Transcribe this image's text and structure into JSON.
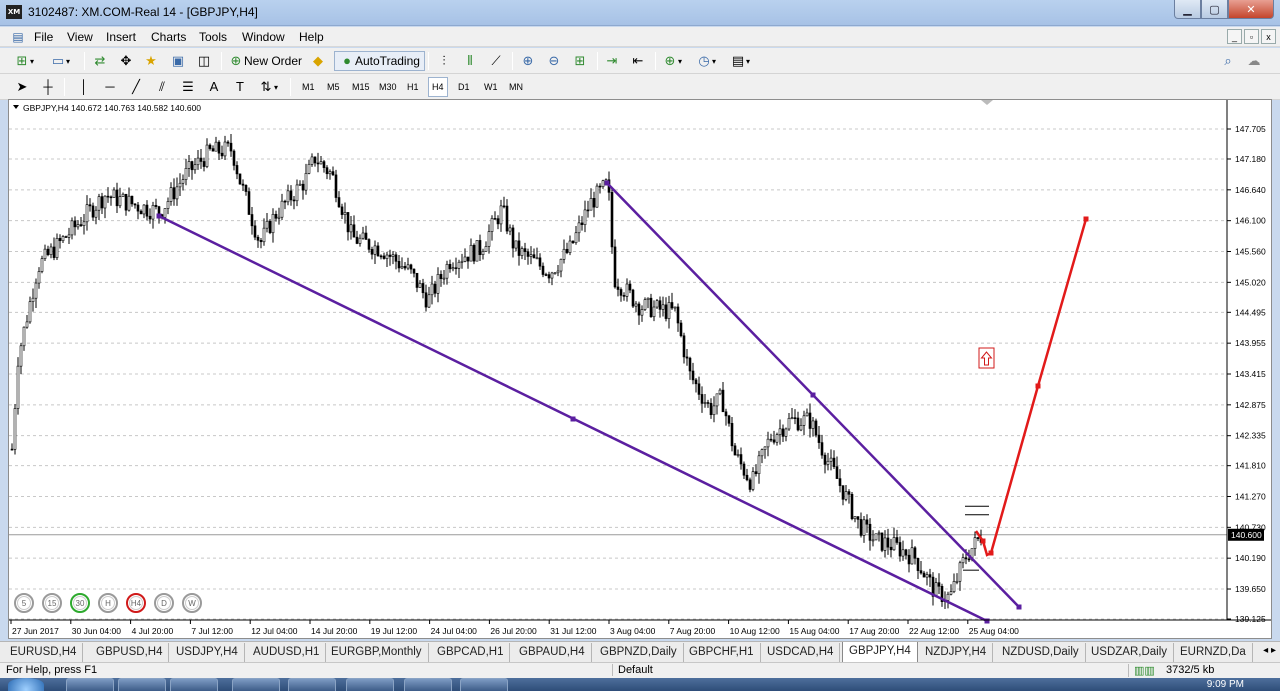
{
  "window": {
    "title": "3102487: XM.COM-Real 14 - [GBPJPY,H4]",
    "app_icon": "XM",
    "buttons": {
      "minimize": "▁",
      "maximize": "▢",
      "close": "✕"
    }
  },
  "menu": {
    "items": [
      "File",
      "View",
      "Insert",
      "Charts",
      "Tools",
      "Window",
      "Help"
    ],
    "mdi": [
      "_",
      "▫",
      "x"
    ]
  },
  "toolbar": {
    "new_order": "New Order",
    "autotrading": "AutoTrading",
    "timeframes": [
      "M1",
      "M5",
      "M15",
      "M30",
      "H1",
      "H4",
      "D1",
      "W1",
      "MN"
    ],
    "active_timeframe": "H4",
    "tools_text": "A"
  },
  "chart": {
    "header": "GBPJPY,H4  140.672 140.763 140.582 140.600",
    "current_price": "140.600",
    "price_labels": [
      "147.705",
      "147.180",
      "146.640",
      "146.100",
      "145.560",
      "145.020",
      "144.495",
      "143.955",
      "143.415",
      "142.875",
      "142.335",
      "141.810",
      "141.270",
      "140.730",
      "140.190",
      "139.650",
      "139.125"
    ],
    "time_labels": [
      "27 Jun 2017",
      "30 Jun 04:00",
      "4 Jul 20:00",
      "7 Jul 12:00",
      "12 Jul 04:00",
      "14 Jul 20:00",
      "19 Jul 12:00",
      "24 Jul 04:00",
      "26 Jul 20:00",
      "31 Jul 12:00",
      "3 Aug 04:00",
      "7 Aug 20:00",
      "10 Aug 12:00",
      "15 Aug 04:00",
      "17 Aug 20:00",
      "22 Aug 12:00",
      "25 Aug 04:00"
    ],
    "timeframe_circles": [
      {
        "label": "5",
        "color": "#9a9a9a"
      },
      {
        "label": "15",
        "color": "#9a9a9a"
      },
      {
        "label": "30",
        "color": "#2eaa2e"
      },
      {
        "label": "H",
        "color": "#9a9a9a"
      },
      {
        "label": "H4",
        "color": "#d01a1a"
      },
      {
        "label": "D",
        "color": "#9a9a9a"
      },
      {
        "label": "W",
        "color": "#9a9a9a"
      }
    ],
    "colors": {
      "trendline": "#5b1fa0",
      "projection": "#e21a1a",
      "candle": "#000000",
      "grid": "#c8c8c8"
    }
  },
  "tabs": {
    "items": [
      "EURUSD,H4",
      "GBPUSD,H4",
      "USDJPY,H4",
      "AUDUSD,H1",
      "EURGBP,Monthly",
      "GBPCAD,H1",
      "GBPAUD,H4",
      "GBPNZD,Daily",
      "GBPCHF,H1",
      "USDCAD,H4",
      "GBPJPY,H4",
      "NZDJPY,H4",
      "NZDUSD,Daily",
      "USDZAR,Daily",
      "EURNZD,Da"
    ],
    "active": "GBPJPY,H4",
    "arrows": "◂ ▸"
  },
  "status": {
    "help": "For Help, press F1",
    "profile": "Default",
    "traffic": "3732/5 kb"
  },
  "taskbar": {
    "clock": "9:09 PM"
  }
}
